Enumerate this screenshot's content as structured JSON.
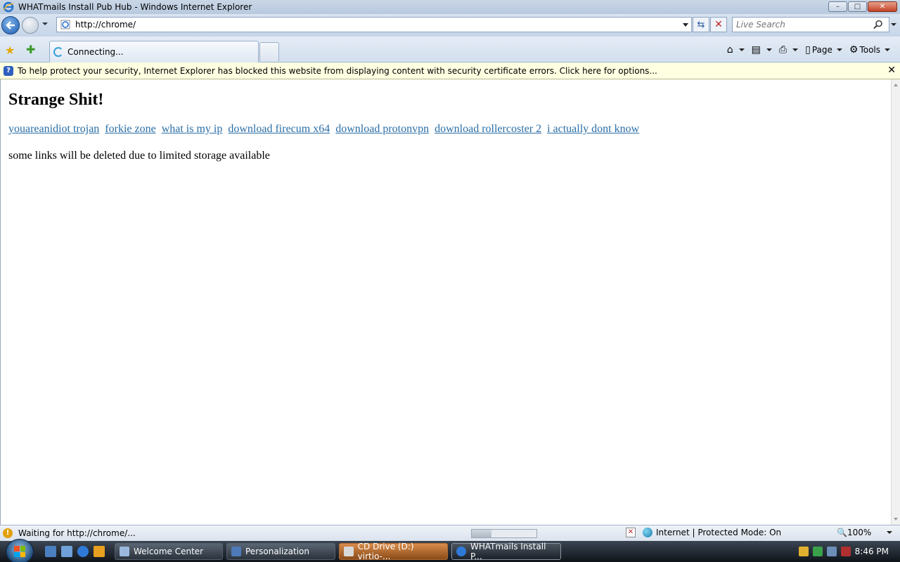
{
  "window": {
    "title": "WHATmails Install Pub Hub - Windows Internet Explorer",
    "minimize": "–",
    "maximize": "□",
    "close": "✕"
  },
  "navbar": {
    "address_url": "http://chrome/",
    "search_placeholder": "Live Search"
  },
  "tabs": [
    {
      "label": "Connecting..."
    }
  ],
  "command_bar": {
    "page_label": "Page",
    "tools_label": "Tools"
  },
  "infobar": {
    "text": "To help protect your security, Internet Explorer has blocked this website from displaying content with security certificate errors. Click here for options...",
    "close": "✕"
  },
  "page": {
    "heading": "Strange Shit!",
    "links": [
      "youareanidiot trojan",
      "forkie zone",
      "what is my ip",
      "download firecum x64",
      "download protonvpn",
      "download rollercoster 2",
      "i actually dont know"
    ],
    "note": "some links will be deleted due to limited storage available"
  },
  "statusbar": {
    "text": "Waiting for http://chrome/...",
    "zone": "Internet | Protected Mode: On",
    "zoom": "100%",
    "progress": 0.3
  },
  "taskbar": {
    "buttons": [
      {
        "label": "Welcome Center"
      },
      {
        "label": "Personalization"
      },
      {
        "label": "CD Drive (D:) virtio-..."
      },
      {
        "label": "WHATmails Install P..."
      }
    ],
    "clock": "8:46 PM"
  }
}
